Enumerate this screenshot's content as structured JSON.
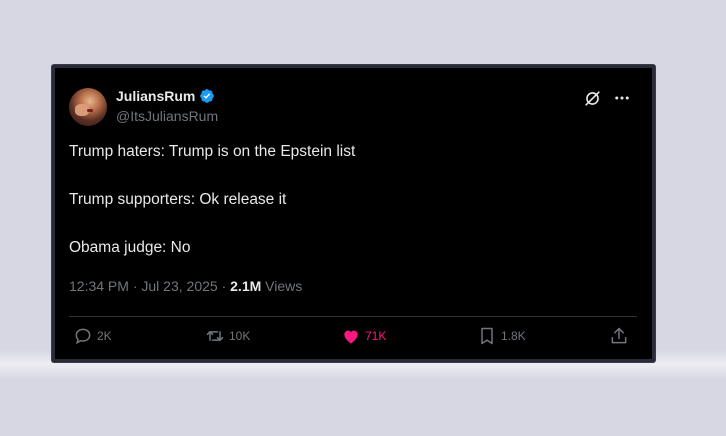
{
  "user": {
    "display_name": "JuliansRum",
    "handle": "@ItsJuliansRum"
  },
  "tweet": {
    "lines": [
      "Trump haters: Trump is on the Epstein list",
      "Trump supporters: Ok release it",
      "Obama judge: No"
    ],
    "time": "12:34 PM",
    "separator": "·",
    "date": "Jul 23, 2025",
    "views_count": "2.1M",
    "views_label": "Views"
  },
  "actions": {
    "replies": "2K",
    "retweets": "10K",
    "likes": "71K",
    "bookmarks": "1.8K"
  },
  "icons": {
    "verified": "verified-badge-icon",
    "grok": "grok-icon",
    "more": "more-icon",
    "reply": "reply-icon",
    "retweet": "retweet-icon",
    "like": "heart-icon",
    "bookmark": "bookmark-icon",
    "share": "share-icon"
  },
  "colors": {
    "background": "#d7d7e3",
    "card": "#000000",
    "text": "#e7e9ea",
    "muted": "#71767b",
    "verified": "#1d9bf0",
    "like": "#f91880"
  }
}
